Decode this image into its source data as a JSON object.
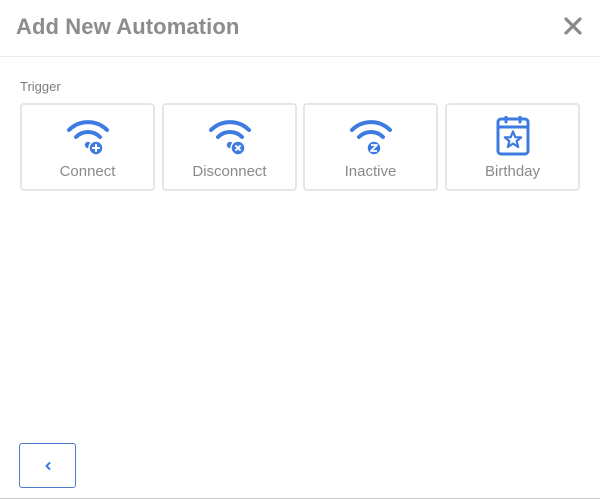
{
  "dialog": {
    "title": "Add New Automation",
    "close_icon": "close-icon"
  },
  "trigger": {
    "section_label": "Trigger",
    "options": [
      {
        "label": "Connect",
        "icon": "wifi-plus-icon"
      },
      {
        "label": "Disconnect",
        "icon": "wifi-x-icon"
      },
      {
        "label": "Inactive",
        "icon": "wifi-sleep-icon"
      },
      {
        "label": "Birthday",
        "icon": "calendar-star-icon"
      }
    ]
  },
  "footer": {
    "back_icon": "chevron-left-icon"
  },
  "colors": {
    "accent": "#3d7be0",
    "title_text": "#8c8c8c",
    "card_border": "#e6e6e6",
    "back_border": "#4f79c9"
  }
}
